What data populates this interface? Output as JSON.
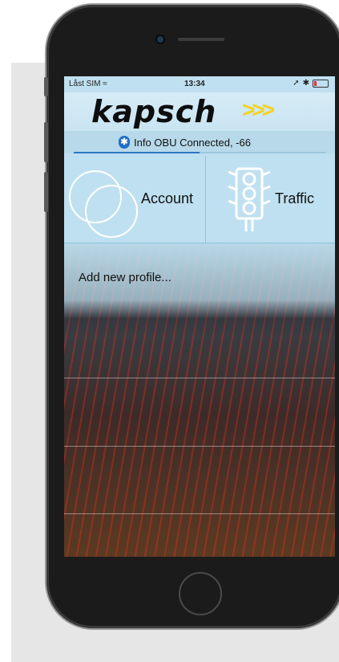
{
  "status": {
    "carrier": "Låst SIM",
    "time": "13:34"
  },
  "header": {
    "logo": "kapsch",
    "arrows": ">>>"
  },
  "info_bar": {
    "text": "Info OBU Connected, -66",
    "progress": 0.5
  },
  "tiles": {
    "account_label": "Account",
    "traffic_label": "Traffic"
  },
  "profiles": {
    "add_label": "Add new profile..."
  },
  "icons": {
    "wifi": "wifi-icon",
    "location": "location-arrow-icon",
    "bluetooth": "bluetooth-icon",
    "battery": "battery-icon"
  },
  "colors": {
    "screen_bg": "#bfe0f0",
    "brand_yellow": "#f4d21f",
    "accent_blue": "#2b78c2"
  }
}
